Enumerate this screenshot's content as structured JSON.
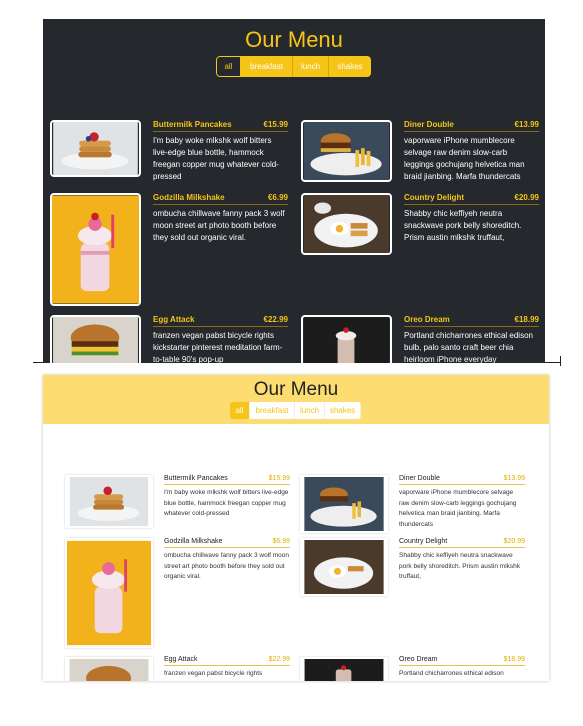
{
  "dark_view": {
    "title": "Our Menu",
    "filters": [
      "all",
      "breakfast",
      "lunch",
      "shakes"
    ],
    "active_filter": "all"
  },
  "light_view": {
    "title": "Our Menu",
    "filters": [
      "all",
      "breakfast",
      "lunch",
      "shakes"
    ],
    "active_filter": "all"
  },
  "dark_items": [
    {
      "name": "Buttermilk Pancakes",
      "price": "€15.99",
      "desc": "I'm baby woke mlkshk wolf bitters live-edge blue bottle, hammock freegan copper mug whatever cold-pressed"
    },
    {
      "name": "Diner Double",
      "price": "€13.99",
      "desc": "vaporware iPhone mumblecore selvage raw denim slow-carb leggings gochujang helvetica man braid jianbing. Marfa thundercats"
    },
    {
      "name": "Godzilla Milkshake",
      "price": "€6.99",
      "desc": "ombucha chillwave fanny pack 3 wolf moon street art photo booth before they sold out organic viral."
    },
    {
      "name": "Country Delight",
      "price": "€20.99",
      "desc": "Shabby chic keffiyeh neutra snackwave pork belly shoreditch. Prism austin mlkshk truffaut,"
    },
    {
      "name": "Egg Attack",
      "price": "€22.99",
      "desc": "franzen vegan pabst bicycle rights kickstarter pinterest meditation farm-to-table 90's pop-up"
    },
    {
      "name": "Oreo Dream",
      "price": "€18.99",
      "desc": "Portland chicharrones ethical edison bulb, palo santo craft beer chia heirloom iPhone everyday"
    }
  ],
  "light_items": [
    {
      "name": "Buttermilk Pancakes",
      "price": "$15.99",
      "desc": "I'm baby woke mlkshk wolf bitters live-edge blue bottle, hammock freegan copper mug whatever cold-pressed"
    },
    {
      "name": "Diner Double",
      "price": "$13.99",
      "desc": "vaporware iPhone mumblecore selvage raw denim slow-carb leggings gochujang helvetica man braid jianbing. Marfa thundercats"
    },
    {
      "name": "Godzilla Milkshake",
      "price": "$6.99",
      "desc": "ombucha chillwave fanny pack 3 wolf moon street art photo booth before they sold out organic viral."
    },
    {
      "name": "Country Delight",
      "price": "$20.99",
      "desc": "Shabby chic keffiyeh neutra snackwave pork belly shoreditch. Prism austin mlkshk truffaut,"
    },
    {
      "name": "Egg Attack",
      "price": "$22.99",
      "desc": "franzen vegan pabst bicycle rights"
    },
    {
      "name": "Oreo Dream",
      "price": "$18.99",
      "desc": "Portland chicharrones ethical edison"
    }
  ],
  "colors": {
    "accent": "#f5c518",
    "dark_bg": "#25282d",
    "light_header": "#fddc72"
  },
  "icons": [
    "pancakes-photo",
    "burger-photo",
    "milkshake-photo",
    "breakfast-plate-photo",
    "egg-burger-photo",
    "oreo-shake-photo"
  ]
}
